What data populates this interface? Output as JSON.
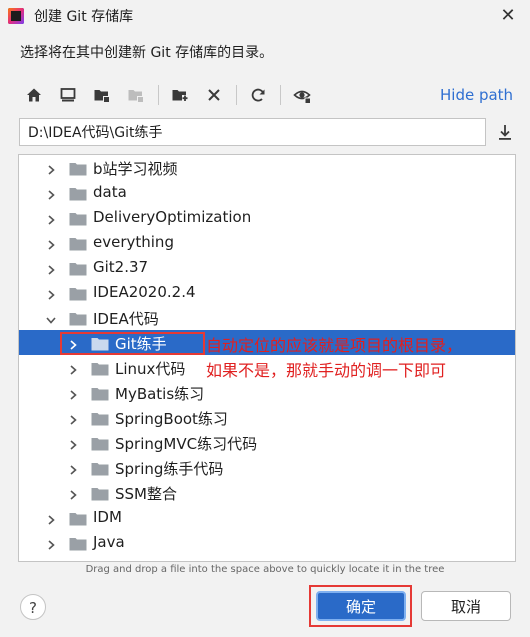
{
  "window": {
    "title": "创建 Git 存储库"
  },
  "description": "选择将在其中创建新 Git 存储库的目录。",
  "toolbar": {
    "icons": [
      "home-icon",
      "desktop-icon",
      "project-folder-icon",
      "module-folder-icon",
      "new-folder-icon",
      "delete-icon",
      "refresh-icon",
      "show-hidden-icon"
    ],
    "hide_path": "Hide path"
  },
  "path": {
    "value": "D:\\IDEA代码\\Git练手"
  },
  "tree": {
    "rows": [
      {
        "label": "b站学习视频",
        "level": 0,
        "expanded": false,
        "selected": false
      },
      {
        "label": "data",
        "level": 0,
        "expanded": false,
        "selected": false
      },
      {
        "label": "DeliveryOptimization",
        "level": 0,
        "expanded": false,
        "selected": false
      },
      {
        "label": "everything",
        "level": 0,
        "expanded": false,
        "selected": false
      },
      {
        "label": "Git2.37",
        "level": 0,
        "expanded": false,
        "selected": false
      },
      {
        "label": "IDEA2020.2.4",
        "level": 0,
        "expanded": false,
        "selected": false
      },
      {
        "label": "IDEA代码",
        "level": 0,
        "expanded": true,
        "selected": false
      },
      {
        "label": "Git练手",
        "level": 1,
        "expanded": false,
        "selected": true
      },
      {
        "label": "Linux代码",
        "level": 1,
        "expanded": false,
        "selected": false
      },
      {
        "label": "MyBatis练习",
        "level": 1,
        "expanded": false,
        "selected": false
      },
      {
        "label": "SpringBoot练习",
        "level": 1,
        "expanded": false,
        "selected": false
      },
      {
        "label": "SpringMVC练习代码",
        "level": 1,
        "expanded": false,
        "selected": false
      },
      {
        "label": "Spring练手代码",
        "level": 1,
        "expanded": false,
        "selected": false
      },
      {
        "label": "SSM整合",
        "level": 1,
        "expanded": false,
        "selected": false
      },
      {
        "label": "IDM",
        "level": 0,
        "expanded": false,
        "selected": false
      },
      {
        "label": "Java",
        "level": 0,
        "expanded": false,
        "selected": false
      }
    ]
  },
  "annotation": {
    "line1": "自动定位的应该就是项目的根目录，",
    "line2": "如果不是，那就手动的调一下即可"
  },
  "hint": "Drag and drop a file into the space above to quickly locate it in the tree",
  "buttons": {
    "help": "?",
    "ok": "确定",
    "cancel": "取消"
  },
  "colors": {
    "accent": "#2a6ac8",
    "link": "#2f6fd1",
    "annotation": "#e02020",
    "folder": "#9aa0a6"
  }
}
